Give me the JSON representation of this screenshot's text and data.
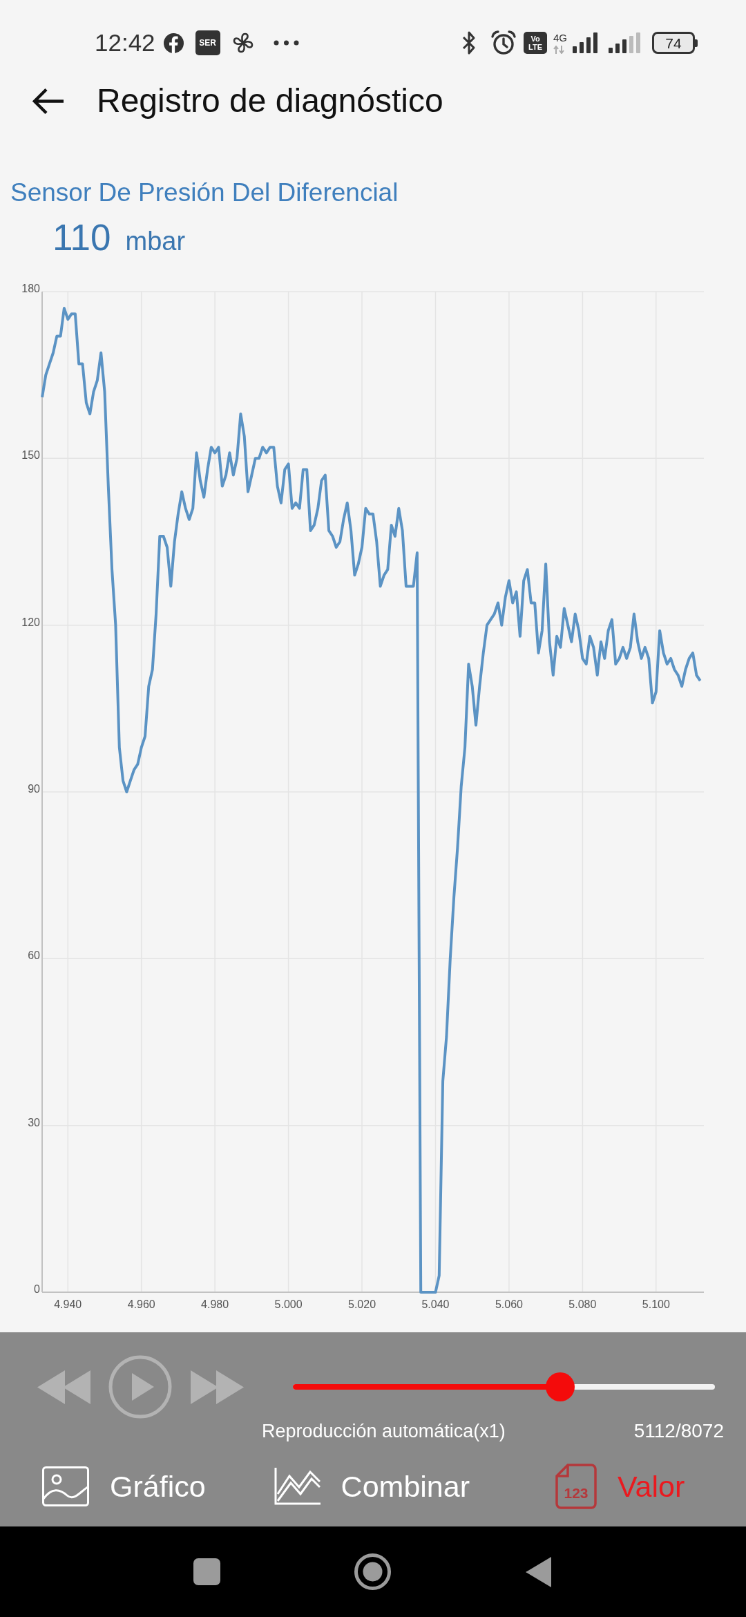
{
  "status_bar": {
    "time": "12:42",
    "app_badge": "SER",
    "volte_badge": [
      "Vo",
      "LTE"
    ],
    "network_type": "4G",
    "battery": "74"
  },
  "header": {
    "title": "Registro de diagnóstico"
  },
  "sensor": {
    "name": "Sensor De Presión Del Diferencial",
    "value": "110",
    "unit": "mbar",
    "chart_data": {
      "type": "line",
      "grid": true,
      "x": [
        4933,
        4934,
        4935,
        4936,
        4937,
        4938,
        4939,
        4940,
        4941,
        4942,
        4943,
        4944,
        4945,
        4946,
        4947,
        4948,
        4949,
        4950,
        4951,
        4952,
        4953,
        4954,
        4955,
        4956,
        4957,
        4958,
        4959,
        4960,
        4961,
        4962,
        4963,
        4964,
        4965,
        4966,
        4967,
        4968,
        4969,
        4970,
        4971,
        4972,
        4973,
        4974,
        4975,
        4976,
        4977,
        4978,
        4979,
        4980,
        4981,
        4982,
        4983,
        4984,
        4985,
        4986,
        4987,
        4988,
        4989,
        4990,
        4991,
        4992,
        4993,
        4994,
        4995,
        4996,
        4997,
        4998,
        4999,
        5000,
        5001,
        5002,
        5003,
        5004,
        5005,
        5006,
        5007,
        5008,
        5009,
        5010,
        5011,
        5012,
        5013,
        5014,
        5015,
        5016,
        5017,
        5018,
        5019,
        5020,
        5021,
        5022,
        5023,
        5024,
        5025,
        5026,
        5027,
        5028,
        5029,
        5030,
        5031,
        5032,
        5033,
        5034,
        5035,
        5036,
        5037,
        5038,
        5039,
        5040,
        5041,
        5042,
        5043,
        5044,
        5045,
        5046,
        5047,
        5048,
        5049,
        5050,
        5051,
        5052,
        5053,
        5054,
        5055,
        5056,
        5057,
        5058,
        5059,
        5060,
        5061,
        5062,
        5063,
        5064,
        5065,
        5066,
        5067,
        5068,
        5069,
        5070,
        5071,
        5072,
        5073,
        5074,
        5075,
        5076,
        5077,
        5078,
        5079,
        5080,
        5081,
        5082,
        5083,
        5084,
        5085,
        5086,
        5087,
        5088,
        5089,
        5090,
        5091,
        5092,
        5093,
        5094,
        5095,
        5096,
        5097,
        5098,
        5099,
        5100,
        5101,
        5102,
        5103,
        5104,
        5105,
        5106,
        5107,
        5108,
        5109,
        5110,
        5111,
        5112
      ],
      "series": [
        {
          "color": "#5b93c4",
          "values": [
            161,
            165,
            167,
            169,
            172,
            172,
            177,
            175,
            176,
            176,
            167,
            167,
            160,
            158,
            162,
            164,
            169,
            162,
            145,
            130,
            120,
            98,
            92,
            90,
            92,
            94,
            95,
            98,
            100,
            109,
            112,
            122,
            136,
            136,
            134,
            127,
            135,
            140,
            144,
            141,
            139,
            141,
            151,
            146,
            143,
            148,
            152,
            151,
            152,
            145,
            147,
            151,
            147,
            150,
            158,
            154,
            144,
            147,
            150,
            150,
            152,
            151,
            152,
            152,
            145,
            142,
            148,
            149,
            141,
            142,
            141,
            148,
            148,
            137,
            138,
            141,
            146,
            147,
            137,
            136,
            134,
            135,
            139,
            142,
            137,
            129,
            131,
            134,
            141,
            140,
            140,
            135,
            127,
            129,
            130,
            138,
            136,
            141,
            137,
            127,
            127,
            127,
            133,
            0,
            0,
            0,
            0,
            0,
            3,
            38,
            46,
            60,
            71,
            80,
            91,
            98,
            113,
            109,
            102,
            109,
            115,
            120,
            121,
            122,
            124,
            120,
            125,
            128,
            124,
            126,
            118,
            128,
            130,
            124,
            124,
            115,
            119,
            131,
            117,
            111,
            118,
            116,
            123,
            120,
            117,
            122,
            119,
            114,
            113,
            118,
            116,
            111,
            117,
            114,
            119,
            121,
            113,
            114,
            116,
            114,
            116,
            122,
            117,
            114,
            116,
            114,
            106,
            108,
            119,
            115,
            113,
            114,
            112,
            111,
            109,
            112,
            114,
            115,
            111,
            110
          ]
        }
      ],
      "xlim": [
        4933,
        5113
      ],
      "ylim": [
        0,
        180
      ],
      "yticks": [
        0,
        30,
        60,
        90,
        120,
        150,
        180
      ],
      "xticks": [
        {
          "value": 4940,
          "label": "4.940"
        },
        {
          "value": 4960,
          "label": "4.960"
        },
        {
          "value": 4980,
          "label": "4.980"
        },
        {
          "value": 5000,
          "label": "5.000"
        },
        {
          "value": 5020,
          "label": "5.020"
        },
        {
          "value": 5040,
          "label": "5.040"
        },
        {
          "value": 5060,
          "label": "5.060"
        },
        {
          "value": 5080,
          "label": "5.080"
        },
        {
          "value": 5100,
          "label": "5.100"
        }
      ]
    }
  },
  "playback": {
    "level": 0.633,
    "mode_label": "Reproducción automática(x1)",
    "position": "5112/8072"
  },
  "tabs": [
    {
      "label": "Gráfico",
      "kind": "image",
      "selected": false
    },
    {
      "label": "Combinar",
      "kind": "combine",
      "selected": false
    },
    {
      "label": "Valor",
      "kind": "value",
      "icon_text": "123",
      "selected": true
    }
  ]
}
